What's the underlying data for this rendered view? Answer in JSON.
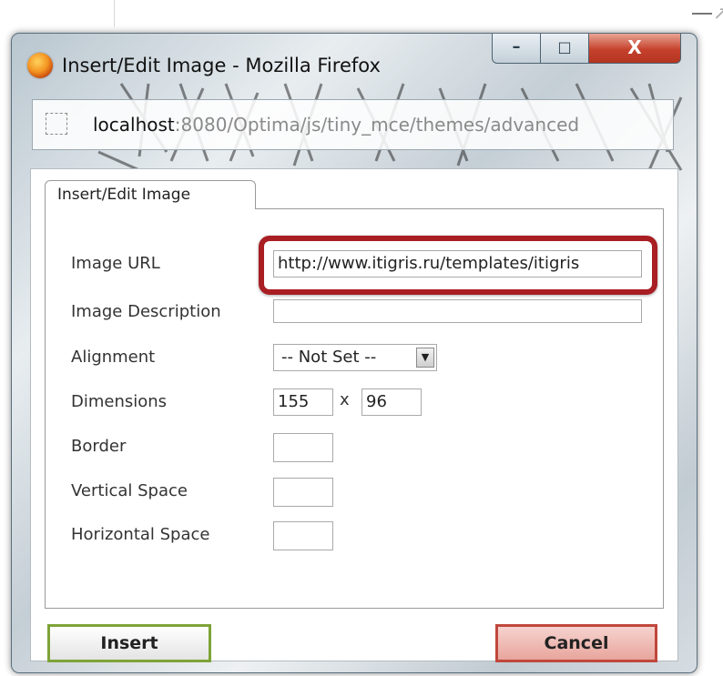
{
  "window": {
    "title": "Insert/Edit Image - Mozilla Firefox",
    "controls": {
      "minimize": "–",
      "maximize": "□",
      "close": "X"
    }
  },
  "address_bar": {
    "host": "localhost",
    "rest": ":8080/Optima/js/tiny_mce/themes/advanced"
  },
  "dialog": {
    "tab_label": "Insert/Edit Image",
    "fields": {
      "image_url": {
        "label": "Image URL",
        "value": "http://www.itigris.ru/templates/itigris"
      },
      "image_description": {
        "label": "Image Description",
        "value": ""
      },
      "alignment": {
        "label": "Alignment",
        "selected": "-- Not Set --"
      },
      "dimensions": {
        "label": "Dimensions",
        "width": "155",
        "separator": "x",
        "height": "96"
      },
      "border": {
        "label": "Border",
        "value": ""
      },
      "vertical_space": {
        "label": "Vertical Space",
        "value": ""
      },
      "horizontal_space": {
        "label": "Horizontal Space",
        "value": ""
      }
    },
    "buttons": {
      "insert": "Insert",
      "cancel": "Cancel"
    }
  },
  "colors": {
    "highlight": "#a81e23",
    "close_button": "#c5412c",
    "insert_border": "#7ea338",
    "cancel_border": "#c0473c"
  },
  "icons": [
    "firefox-icon",
    "page-icon",
    "dropdown-arrow-icon"
  ]
}
